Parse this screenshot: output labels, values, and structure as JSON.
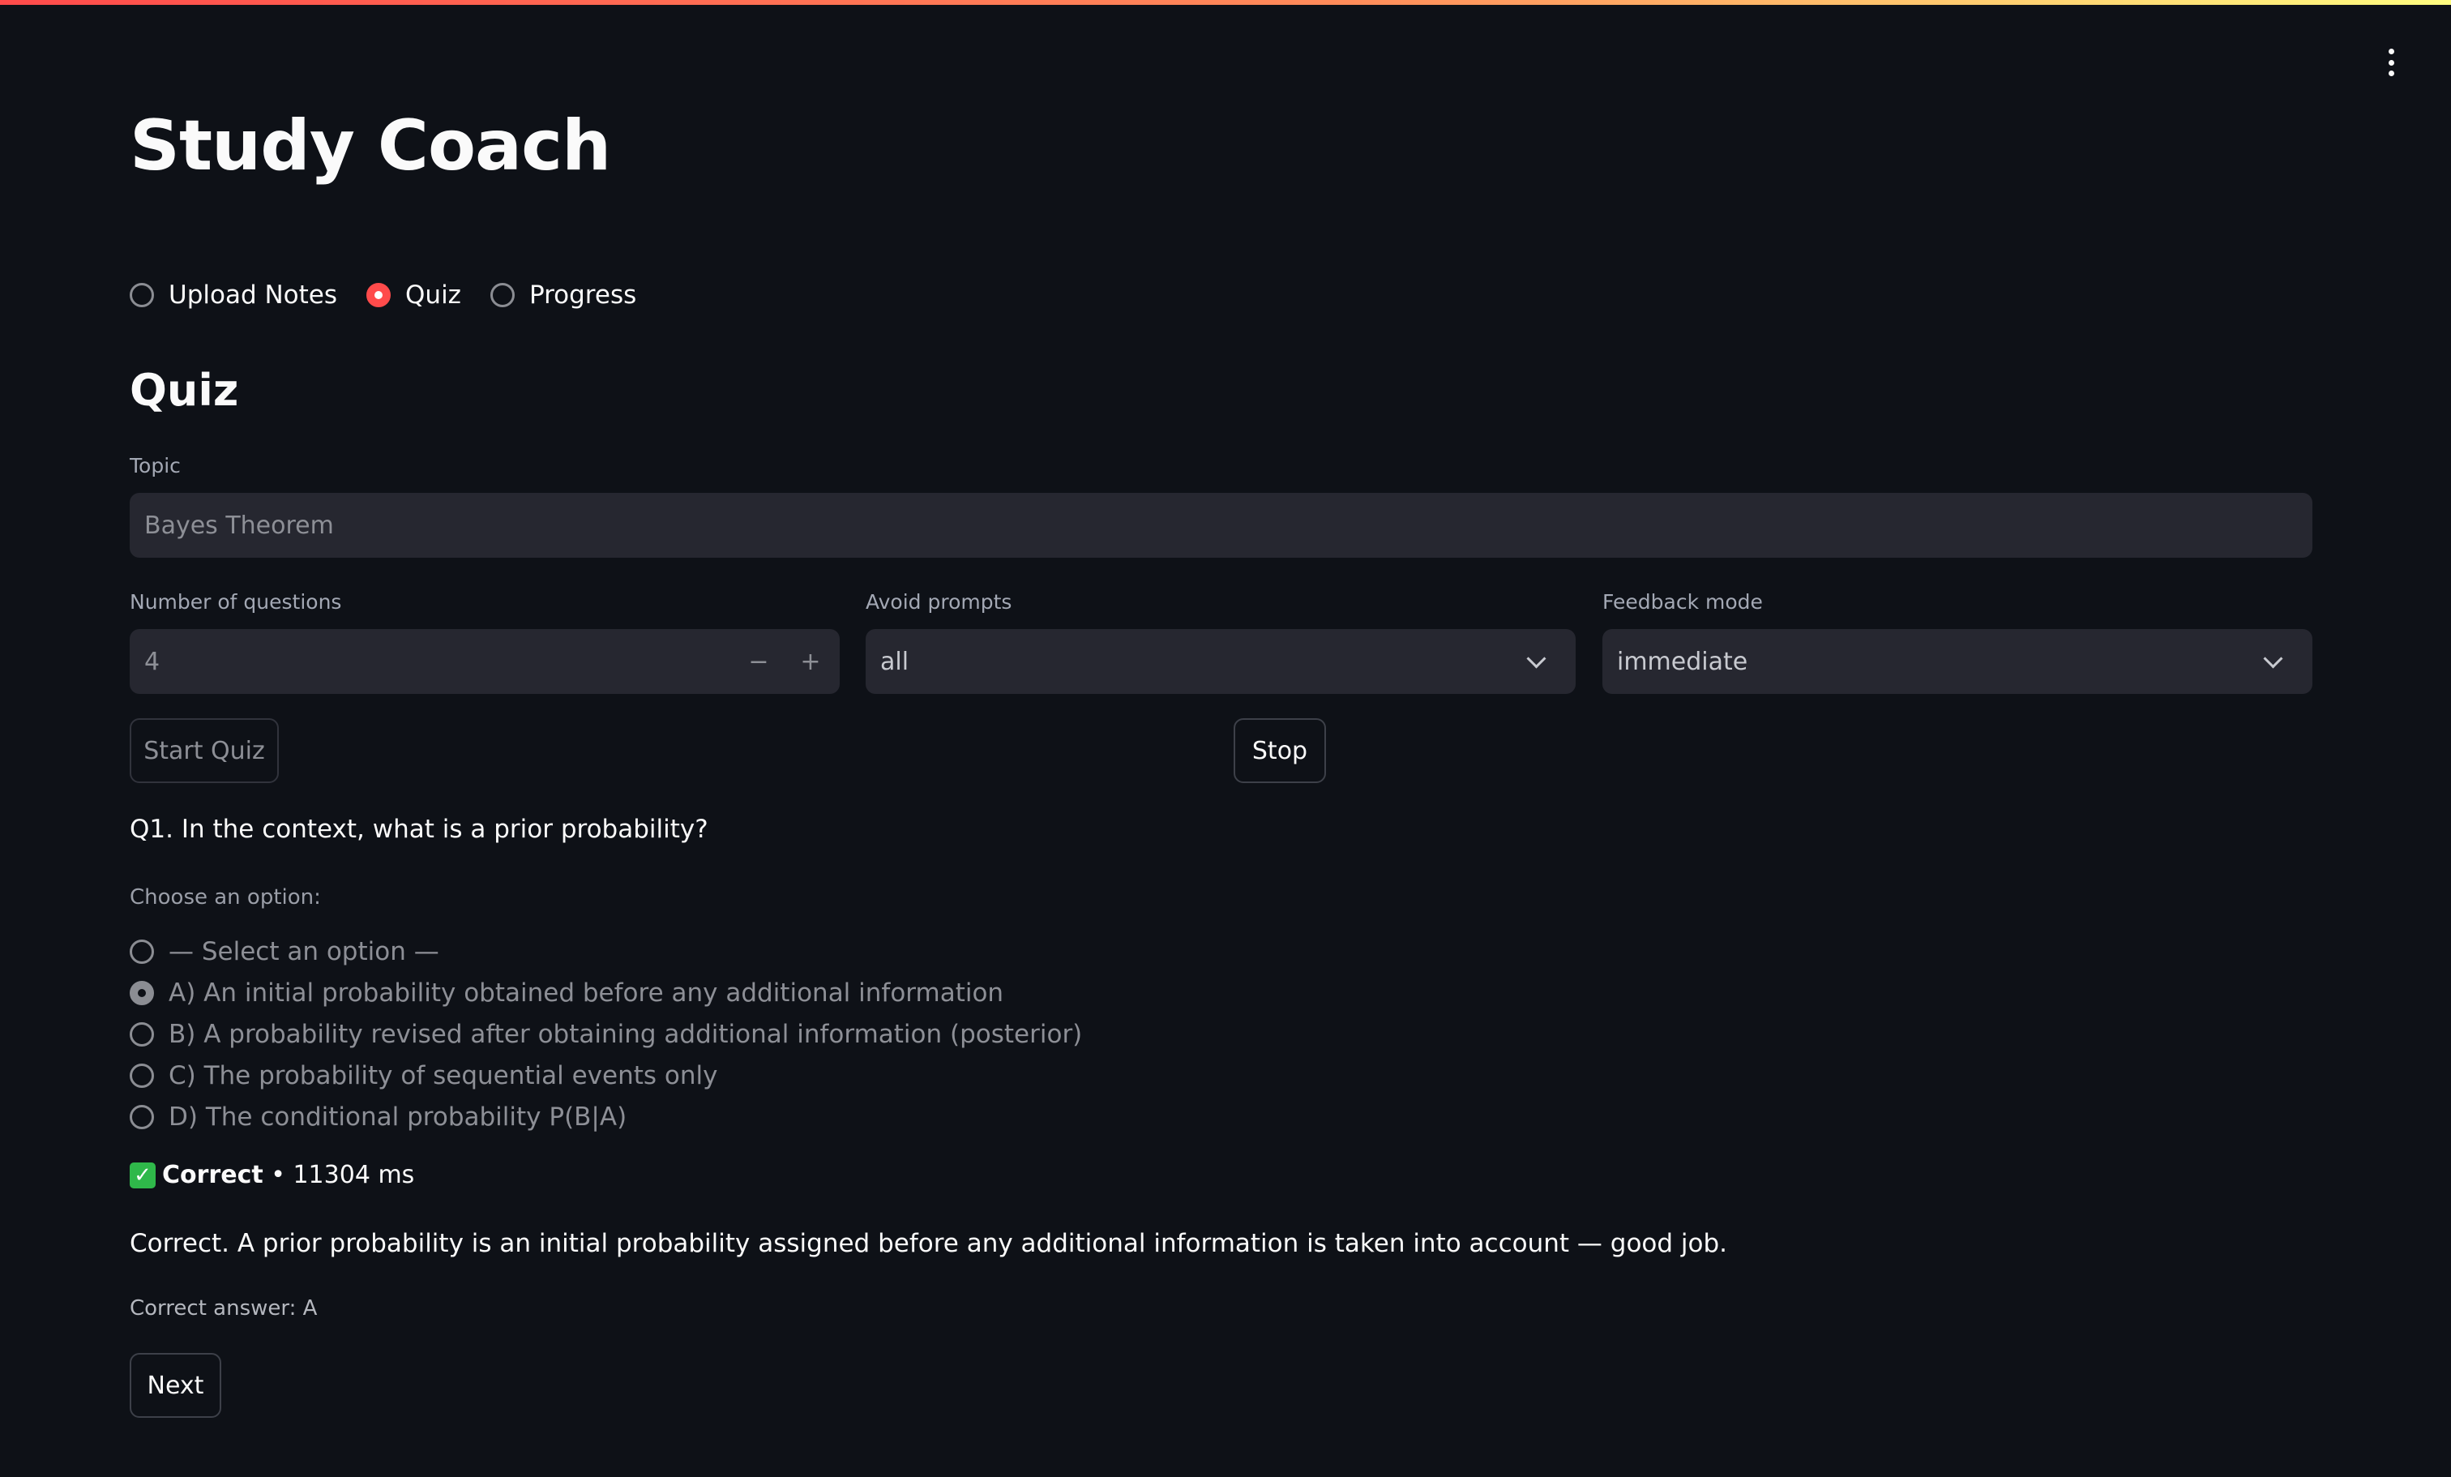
{
  "app": {
    "title": "Study Coach",
    "accent_color": "#ff4b4b",
    "menu_icon": "more-vertical-icon"
  },
  "nav": {
    "items": [
      {
        "label": "Upload Notes",
        "selected": false
      },
      {
        "label": "Quiz",
        "selected": true
      },
      {
        "label": "Progress",
        "selected": false
      }
    ]
  },
  "quiz": {
    "heading": "Quiz",
    "topic": {
      "label": "Topic",
      "value": "Bayes Theorem"
    },
    "num_questions": {
      "label": "Number of questions",
      "value": "4",
      "minus": "−",
      "plus": "+"
    },
    "avoid_prompts": {
      "label": "Avoid prompts",
      "value": "all"
    },
    "feedback_mode": {
      "label": "Feedback mode",
      "value": "immediate"
    },
    "start_button": "Start Quiz",
    "stop_button": "Stop",
    "question": "Q1. In the context, what is a prior probability?",
    "choose_label": "Choose an option:",
    "options": [
      {
        "label": "— Select an option —",
        "selected": false
      },
      {
        "label": "A) An initial probability obtained before any additional information",
        "selected": true
      },
      {
        "label": "B) A probability revised after obtaining additional information (posterior)",
        "selected": false
      },
      {
        "label": "C) The probability of sequential events only",
        "selected": false
      },
      {
        "label": "D) The conditional probability P(B|A)",
        "selected": false
      }
    ],
    "result": {
      "icon": "check-mark-icon",
      "status": "Correct",
      "separator": " • ",
      "time": "11304 ms",
      "color": "#2fb84a"
    },
    "explanation": "Correct. A prior probability is an initial probability assigned before any additional information is taken into account — good job.",
    "correct_answer": "Correct answer: A",
    "next_button": "Next"
  }
}
